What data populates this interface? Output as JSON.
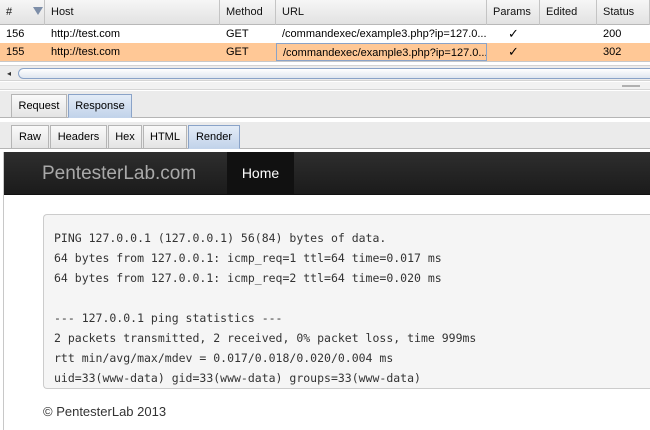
{
  "history_table": {
    "columns": [
      "#",
      "Host",
      "Method",
      "URL",
      "Params",
      "Edited",
      "Status"
    ],
    "rows": [
      {
        "num": "156",
        "host": "http://test.com",
        "method": "GET",
        "url": "/commandexec/example3.php?ip=127.0...",
        "params": "✓",
        "edited": "",
        "status": "200"
      },
      {
        "num": "155",
        "host": "http://test.com",
        "method": "GET",
        "url": "/commandexec/example3.php?ip=127.0...",
        "params": "✓",
        "edited": "",
        "status": "302"
      }
    ],
    "selected_row": 1,
    "highlight_color": "#ffc896"
  },
  "scrollbar": {
    "left_arrow": "◂"
  },
  "message_tabs": {
    "items": [
      "Request",
      "Response"
    ],
    "active": "Response"
  },
  "view_tabs": {
    "items": [
      "Raw",
      "Headers",
      "Hex",
      "HTML",
      "Render"
    ],
    "active": "Render"
  },
  "rendered_page": {
    "brand": "PentesterLab.com",
    "nav_active": "Home",
    "output_lines": [
      "PING 127.0.0.1 (127.0.0.1) 56(84) bytes of data.",
      "64 bytes from 127.0.0.1: icmp_req=1 ttl=64 time=0.017 ms",
      "64 bytes from 127.0.0.1: icmp_req=2 ttl=64 time=0.020 ms",
      "",
      "--- 127.0.0.1 ping statistics ---",
      "2 packets transmitted, 2 received, 0% packet loss, time 999ms",
      "rtt min/avg/max/mdev = 0.017/0.018/0.020/0.004 ms",
      "uid=33(www-data) gid=33(www-data) groups=33(www-data)"
    ],
    "footer": "© PentesterLab 2013"
  }
}
